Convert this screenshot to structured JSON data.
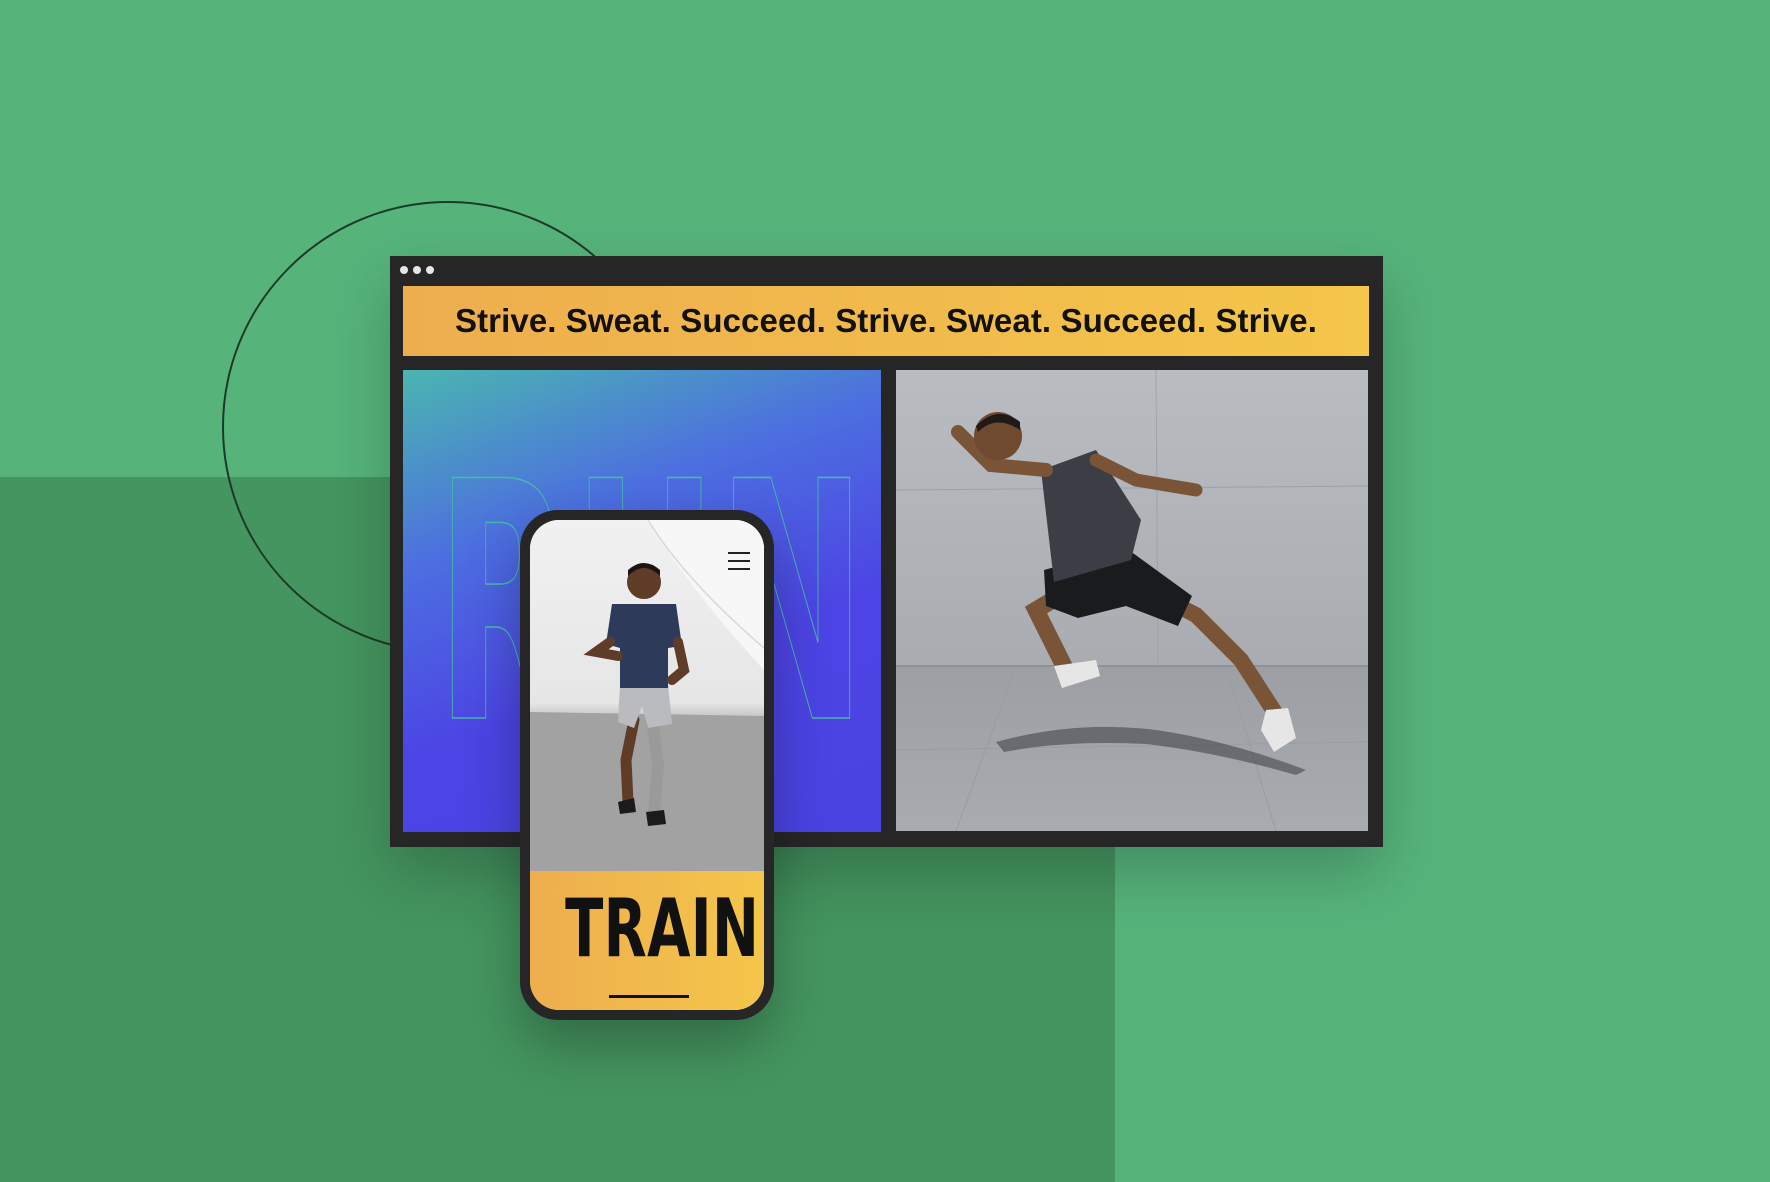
{
  "browser": {
    "marquee_text": "Strive. Sweat. Succeed. Strive. Sweat. Succeed. Strive.",
    "hero_word": "RUN",
    "right_image": "sprinting-athlete-photo"
  },
  "phone": {
    "photo": "running-athlete-photo",
    "menu_icon": "hamburger-menu-icon",
    "cta_word": "TRAIN"
  },
  "colors": {
    "background": "#56b47b",
    "background_block": "#44955f",
    "frame": "#262626",
    "marquee_start": "#eeae4e",
    "marquee_end": "#f4c64a",
    "panel_blue": "#4c44e4",
    "panel_teal": "#4ab6b0"
  }
}
